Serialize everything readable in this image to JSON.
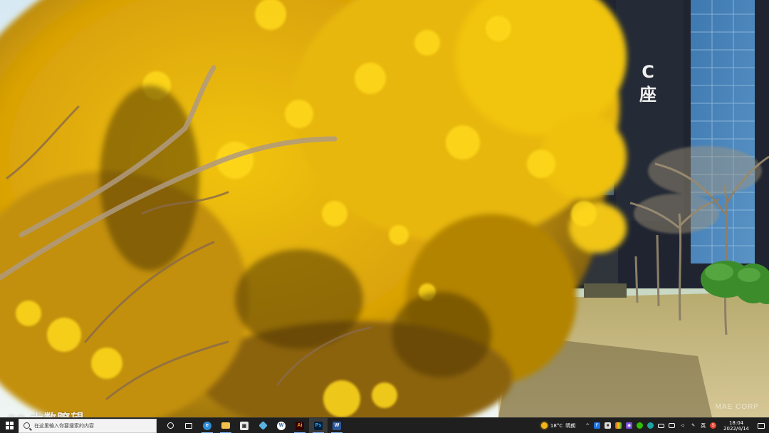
{
  "wallpaper": {
    "building_sign_line1": "C",
    "building_sign_line2": "座"
  },
  "watermark": {
    "text": "大数瞭望",
    "corner_text": "MAE CORP"
  },
  "taskbar": {
    "search_placeholder": "在这里输入你要搜索的内容",
    "apps": [
      {
        "name": "task-view",
        "glyph": "◯"
      },
      {
        "name": "task-switch",
        "glyph": "⧉"
      },
      {
        "name": "edge",
        "glyph": "e"
      },
      {
        "name": "file-explorer",
        "glyph": "▬"
      },
      {
        "name": "store",
        "glyph": "▣"
      },
      {
        "name": "app-blue",
        "glyph": "◆"
      },
      {
        "name": "app-circle",
        "glyph": "W"
      },
      {
        "name": "illustrator",
        "glyph": "Ai"
      },
      {
        "name": "photoshop",
        "glyph": "Ps"
      },
      {
        "name": "word",
        "glyph": "W"
      }
    ],
    "weather_temp": "18°C",
    "weather_desc": "晴朗",
    "tray_chevron": "^",
    "ime_label": "英",
    "time": "18:04",
    "date": "2022/4/14",
    "colors": {
      "taskbar_bg": "#1f1f1f",
      "running_indicator": "#7cb7ff",
      "edge": "#2e8bd6",
      "explorer": "#f2c14a",
      "illustrator": "#ff9a00",
      "photoshop": "#31a8ff",
      "word": "#2b579a"
    }
  }
}
